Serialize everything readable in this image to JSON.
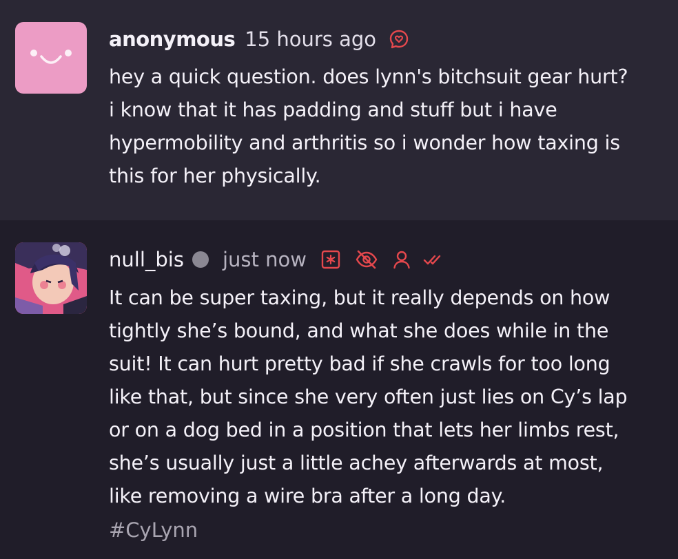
{
  "ask": {
    "author": "anonymous",
    "time": "15 hours ago",
    "lines": [
      "hey a quick question. does lynn's bitchsuit gear hurt?",
      "i know that it has padding and stuff but i have",
      "hypermobility and arthritis so i wonder how taxing is",
      "this for her physically."
    ],
    "icons": [
      "ask-bubble-icon"
    ]
  },
  "answer": {
    "author": "null_bis",
    "time": "just now",
    "lines": [
      "It can be super taxing, but it really depends on how",
      "tightly she’s bound, and what she does while in the",
      "suit! It can hurt pretty bad if she crawls for too long",
      "like that, but since she very often just lies on Cy’s lap",
      "or on a dog bed in a position that lets her limbs rest,",
      "she’s usually just a little achey afterwards at most,",
      "like removing a wire bra after a long day."
    ],
    "tag": "#CyLynn",
    "icons": [
      "sensitive-content-icon",
      "hidden-eye-icon",
      "user-icon",
      "double-check-icon"
    ]
  },
  "colors": {
    "accent": "#e5484d",
    "ask_bg": "#2a2734",
    "answer_bg": "#201d29",
    "avatar_pink": "#ec9cc5"
  }
}
